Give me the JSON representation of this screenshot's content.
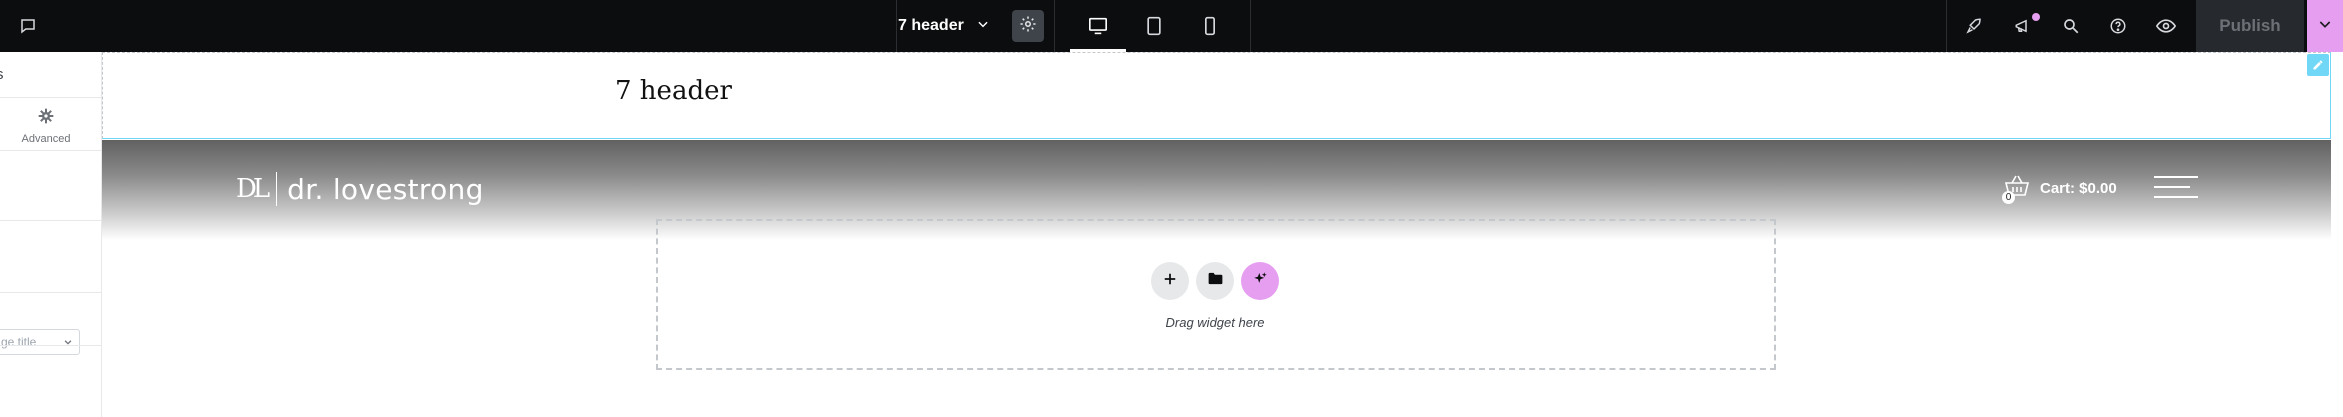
{
  "topbar": {
    "doc_title": "7 header",
    "publish_label": "Publish",
    "colors": {
      "bg": "#0c0d0e",
      "accent": "#e69ff0"
    },
    "left_icon": "chat-bubble-icon",
    "settings_icon": "gear-icon",
    "devices": [
      "desktop-icon",
      "tablet-icon",
      "mobile-icon"
    ],
    "right_icons": [
      "rocket-icon",
      "megaphone-icon",
      "search-icon",
      "help-icon",
      "preview-eye-icon"
    ]
  },
  "left_panel": {
    "header_text": "s",
    "advanced_label": "Advanced",
    "select_value": "ge title"
  },
  "canvas": {
    "page_title": "7 header",
    "logo_mark": "DL",
    "logo_text": "dr. lovestrong",
    "cart_label": "Cart: $0.00",
    "cart_count": "0",
    "drag_text": "Drag widget here",
    "selection_color": "#71d7f7"
  }
}
